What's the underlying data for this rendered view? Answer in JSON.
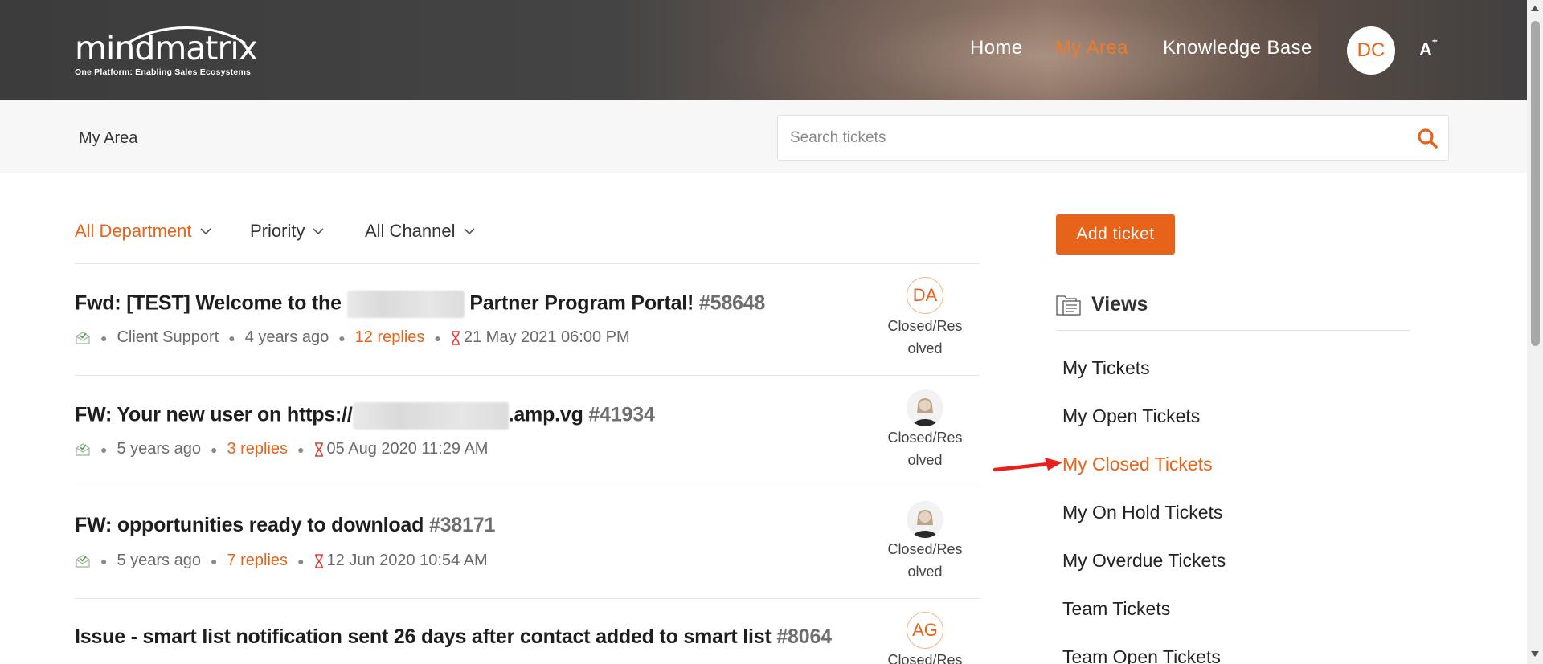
{
  "header": {
    "logo_text": "mindmatrix",
    "logo_tagline": "One Platform: Enabling Sales Ecosystems",
    "nav": {
      "home": "Home",
      "my_area": "My Area",
      "knowledge_base": "Knowledge Base"
    },
    "user_initials": "DC",
    "font_size_label": "A",
    "font_size_sup": "+",
    "active_color": "#e8631a"
  },
  "subheader": {
    "breadcrumb": "My Area",
    "search_placeholder": "Search tickets"
  },
  "filters": {
    "department": "All Department",
    "priority": "Priority",
    "channel": "All Channel"
  },
  "tickets": [
    {
      "title_before": "Fwd: [TEST] Welcome to the",
      "title_after": "Partner Program Portal!",
      "number": "#58648",
      "department": "Client Support",
      "age": "4 years ago",
      "replies": "12 replies",
      "due": "21 May 2021 06:00 PM",
      "agent_initials": "DA",
      "status": "Closed/Res olved"
    },
    {
      "title_before": "FW: Your new user on https://",
      "title_after": ".amp.vg",
      "number": "#41934",
      "age": "5 years ago",
      "replies": "3 replies",
      "due": "05 Aug 2020 11:29 AM",
      "status": "Closed/Res olved"
    },
    {
      "title_before": "FW: opportunities ready to download",
      "number": "#38171",
      "age": "5 years ago",
      "replies": "7 replies",
      "due": "12 Jun 2020 10:54 AM",
      "status": "Closed/Res olved"
    },
    {
      "title_before": "Issue - smart list notification sent 26 days after contact added to smart list",
      "number": "#8064",
      "agent_initials": "AG",
      "status": "Closed/Res"
    }
  ],
  "sidebar": {
    "add_ticket": "Add ticket",
    "views_title": "Views",
    "views": [
      "My Tickets",
      "My Open Tickets",
      "My Closed Tickets",
      "My On Hold Tickets",
      "My Overdue Tickets",
      "Team Tickets",
      "Team Open Tickets"
    ],
    "active_view": "My Closed Tickets"
  }
}
